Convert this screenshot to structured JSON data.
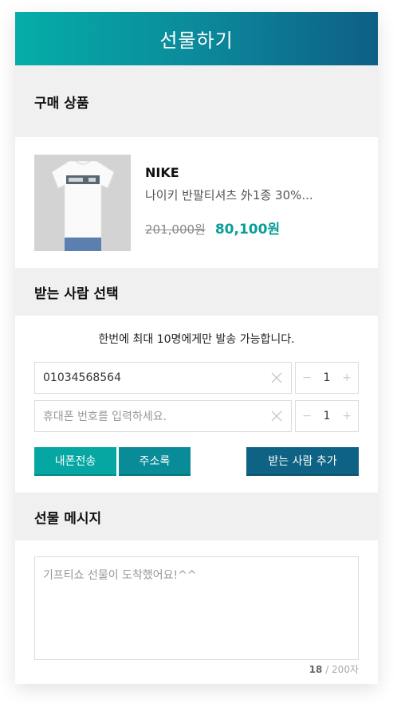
{
  "header": {
    "title": "선물하기"
  },
  "purchase": {
    "section_title": "구매 상품",
    "brand": "NIKE",
    "product_name": "나이키 반팔티셔츠 外1종 30%...",
    "original_price": "201,000원",
    "sale_price": "80,100원",
    "image_icon": "t-shirt-product-photo"
  },
  "recipients": {
    "section_title": "받는 사람 선택",
    "notice": "한번에 최대 10명에게만 발송 가능합니다.",
    "rows": [
      {
        "value": "01034568564",
        "placeholder": "",
        "qty": "1"
      },
      {
        "value": "",
        "placeholder": "휴대폰 번호를 입력하세요.",
        "qty": "1"
      }
    ],
    "minus_symbol": "−",
    "plus_symbol": "+",
    "buttons": {
      "my_phone": "내폰전송",
      "address_book": "주소록",
      "add_recipient": "받는 사람 추가"
    }
  },
  "message": {
    "section_title": "선물 메시지",
    "placeholder": "기프티쇼 선물이 도착했어요!^^",
    "count": "18",
    "limit": "/ 200자"
  },
  "colors": {
    "accent": "#0a9e9a",
    "header_start": "#05ada8",
    "header_end": "#0e5f86",
    "button_dark": "#0e6283"
  }
}
